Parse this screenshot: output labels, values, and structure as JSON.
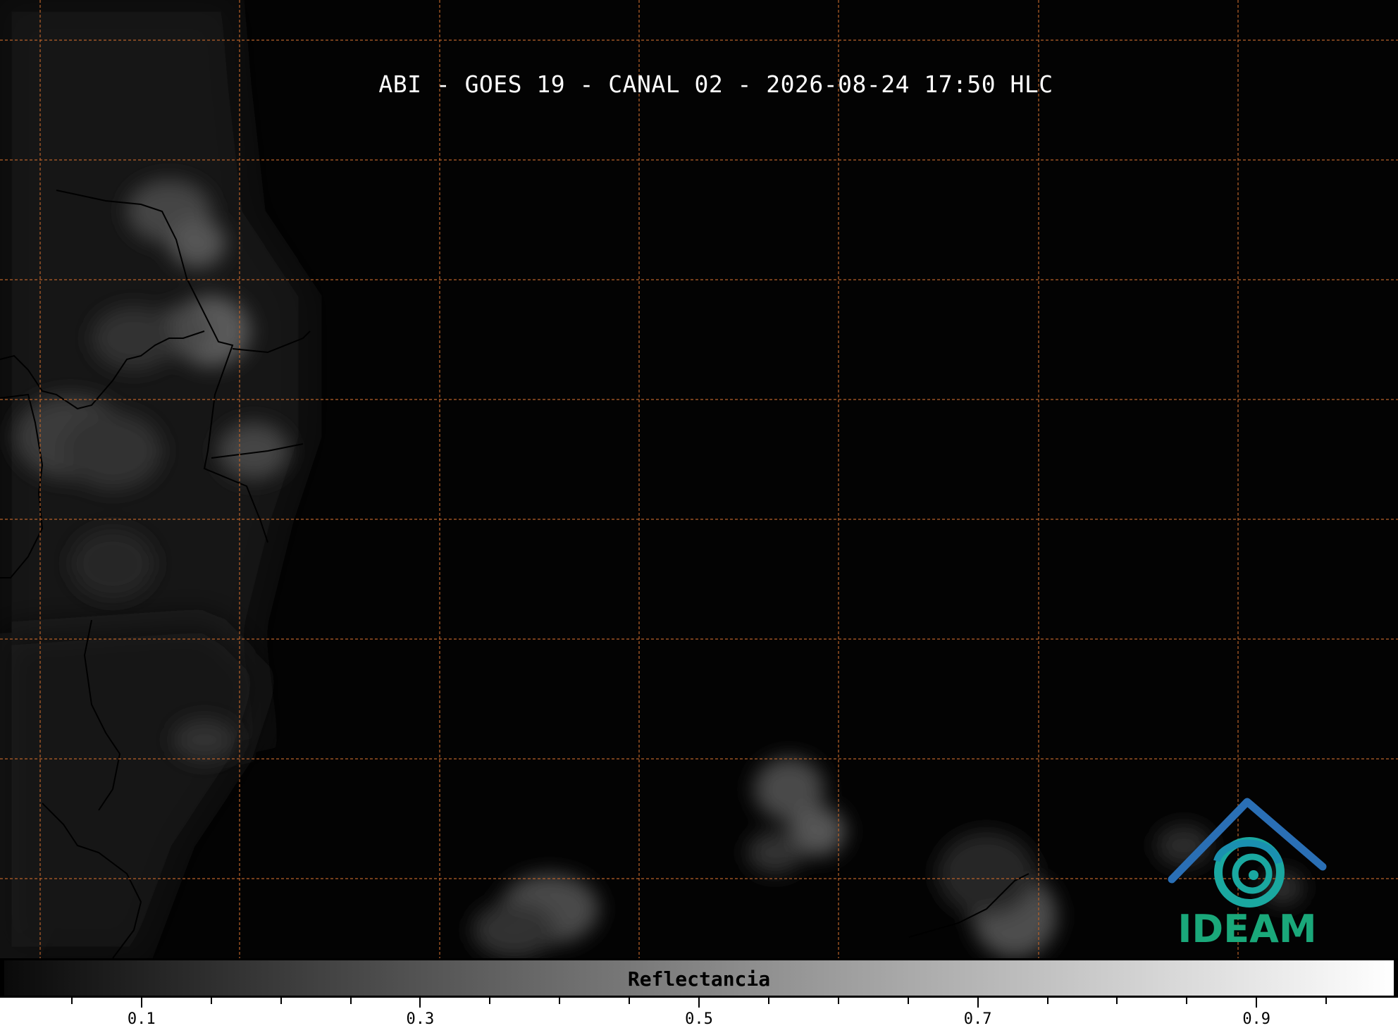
{
  "title": "ABI - GOES 19 - CANAL 02 - 2026-08-24 17:50 HLC",
  "colorbar": {
    "label": "Reflectancia",
    "range": [
      0.0,
      1.0
    ],
    "tick_labels": [
      "0.1",
      "0.3",
      "0.5",
      "0.7",
      "0.9"
    ],
    "major_ticks": [
      0.1,
      0.3,
      0.5,
      0.7,
      0.9
    ],
    "minor_ticks": [
      0.05,
      0.15,
      0.2,
      0.25,
      0.35,
      0.4,
      0.45,
      0.55,
      0.6,
      0.65,
      0.75,
      0.8,
      0.85,
      0.95
    ],
    "gradient_colors": [
      "#0a0a0a",
      "#ffffff"
    ]
  },
  "map": {
    "background_color": "#030303",
    "graticule_color": "#b8622a",
    "cloud_color": "#bdbdbd",
    "border_color": "#000000"
  },
  "logo": {
    "text": "IDEAM",
    "roof_color": "#2a6fb5",
    "swirl_color": "#1aa8a0",
    "text_color": "#1aa87a"
  }
}
